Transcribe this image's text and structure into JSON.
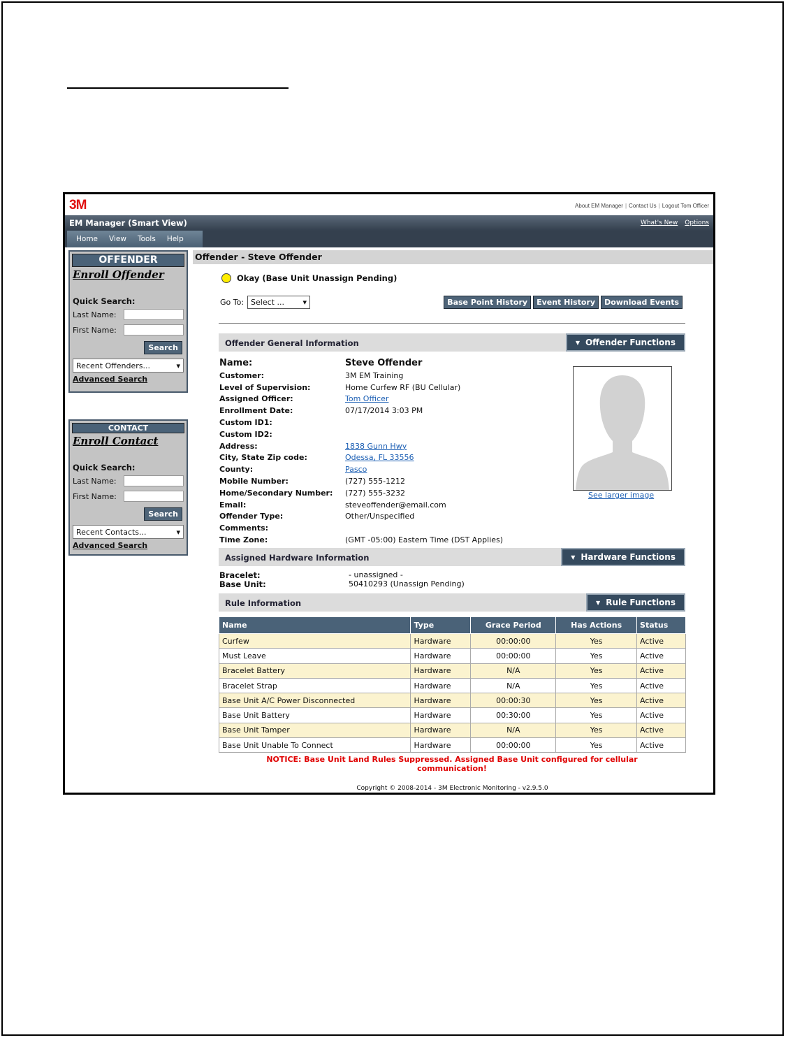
{
  "app": {
    "logo": "3M",
    "top_links": [
      "About EM Manager",
      "Contact Us",
      "Logout Tom Officer"
    ],
    "title": "EM Manager (Smart View)",
    "title_links": [
      "What's New",
      "Options"
    ],
    "menu": [
      "Home",
      "View",
      "Tools",
      "Help"
    ]
  },
  "offender_panel": {
    "header": "OFFENDER",
    "enroll": "Enroll Offender",
    "quick_search": "Quick Search:",
    "last_name_label": "Last Name:",
    "last_name_value": "",
    "first_name_label": "First Name:",
    "first_name_value": "",
    "search_label": "Search",
    "recent": "Recent Offenders...",
    "advanced": "Advanced Search"
  },
  "contact_panel": {
    "header": "CONTACT",
    "enroll": "Enroll Contact",
    "quick_search": "Quick Search:",
    "last_name_label": "Last Name:",
    "last_name_value": "",
    "first_name_label": "First Name:",
    "first_name_value": "",
    "search_label": "Search",
    "recent": "Recent Contacts...",
    "advanced": "Advanced Search"
  },
  "main": {
    "page_title": "Offender - Steve Offender",
    "status": "Okay (Base Unit Unassign Pending)",
    "status_color": "#ffee00",
    "goto_label": "Go To:",
    "goto_value": "Select ...",
    "action_buttons": [
      "Base Point History",
      "Event History",
      "Download Events"
    ]
  },
  "general": {
    "section_title": "Offender General Information",
    "functions_label": "Offender Functions",
    "name_label": "Name:",
    "name_value": "Steve Offender",
    "fields": [
      {
        "label": "Customer:",
        "value": "3M EM Training"
      },
      {
        "label": "Level of Supervision:",
        "value": "Home Curfew RF (BU Cellular)"
      },
      {
        "label": "Assigned Officer:",
        "value": "Tom Officer"
      },
      {
        "label": "Enrollment Date:",
        "value": "07/17/2014 3:03 PM"
      },
      {
        "label": "Custom ID1:",
        "value": ""
      },
      {
        "label": "Custom ID2:",
        "value": ""
      },
      {
        "label": "Address:",
        "value": "1838 Gunn Hwy"
      },
      {
        "label": "City, State Zip code:",
        "value": "Odessa, FL 33556"
      },
      {
        "label": "County:",
        "value": "Pasco"
      },
      {
        "label": "Mobile Number:",
        "value": "(727) 555-1212"
      },
      {
        "label": "Home/Secondary Number:",
        "value": "(727) 555-3232"
      },
      {
        "label": "Email:",
        "value": "steveoffender@email.com"
      },
      {
        "label": "Offender Type:",
        "value": "Other/Unspecified"
      },
      {
        "label": "Comments:",
        "value": ""
      },
      {
        "label": "Time Zone:",
        "value": "(GMT -05:00) Eastern Time (DST Applies)"
      }
    ],
    "photo_link": "See larger image"
  },
  "hardware": {
    "section_title": "Assigned Hardware Information",
    "functions_label": "Hardware Functions",
    "bracelet_label": "Bracelet:",
    "bracelet_value": "- unassigned -",
    "base_unit_label": "Base Unit:",
    "base_unit_value": "50410293 (Unassign Pending)"
  },
  "rules": {
    "section_title": "Rule Information",
    "functions_label": "Rule Functions",
    "columns": [
      "Name",
      "Type",
      "Grace Period",
      "Has Actions",
      "Status"
    ],
    "rows": [
      [
        "Curfew",
        "Hardware",
        "00:00:00",
        "Yes",
        "Active"
      ],
      [
        "Must Leave",
        "Hardware",
        "00:00:00",
        "Yes",
        "Active"
      ],
      [
        "Bracelet Battery",
        "Hardware",
        "N/A",
        "Yes",
        "Active"
      ],
      [
        "Bracelet Strap",
        "Hardware",
        "N/A",
        "Yes",
        "Active"
      ],
      [
        "Base Unit A/C Power Disconnected",
        "Hardware",
        "00:00:30",
        "Yes",
        "Active"
      ],
      [
        "Base Unit Battery",
        "Hardware",
        "00:30:00",
        "Yes",
        "Active"
      ],
      [
        "Base Unit Tamper",
        "Hardware",
        "N/A",
        "Yes",
        "Active"
      ],
      [
        "Base Unit Unable To Connect",
        "Hardware",
        "00:00:00",
        "Yes",
        "Active"
      ]
    ],
    "notice": "NOTICE: Base Unit Land Rules Suppressed. Assigned Base Unit configured for cellular communication!"
  },
  "footer": {
    "copyright": "Copyright © 2008-2014 - 3M Electronic Monitoring - v2.9.5.0"
  }
}
